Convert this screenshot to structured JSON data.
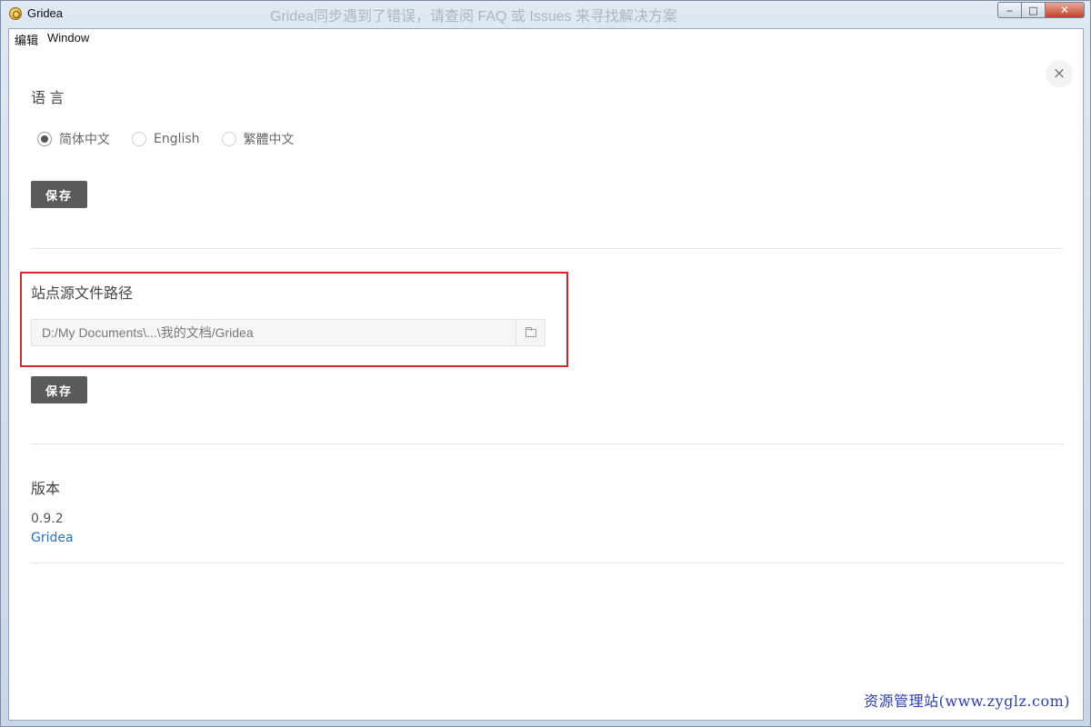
{
  "window": {
    "title": "Gridea",
    "title_notice": "Gridea同步遇到了错误，请查阅 FAQ 或 Issues 来寻找解决方案",
    "minimize_label": "‒",
    "maximize_label": "□",
    "close_label": "✕"
  },
  "menu": {
    "items": [
      "编辑",
      "Window"
    ]
  },
  "panel": {
    "close_label": "×"
  },
  "language": {
    "title": "语 言",
    "options": [
      "简体中文",
      "English",
      "繁體中文"
    ],
    "selected": "简体中文",
    "save_label": "保存"
  },
  "source_path": {
    "title": "站点源文件路径",
    "value": "D:/My Documents\\...\\我的文档/Gridea",
    "save_label": "保存"
  },
  "version": {
    "title": "版本",
    "number": "0.9.2",
    "link_text": "Gridea"
  },
  "watermark": "资源管理站(www.zyglz.com)"
}
